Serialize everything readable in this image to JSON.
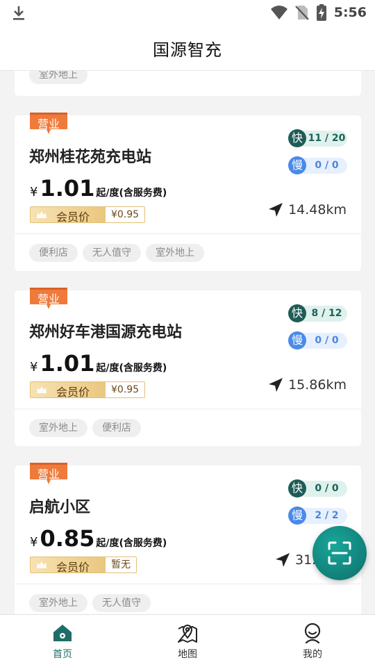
{
  "status_bar": {
    "time": "5:56"
  },
  "header": {
    "title": "国源智充"
  },
  "stub_card": {
    "tags": [
      "室外地上"
    ]
  },
  "stations": [
    {
      "ribbon": "营业",
      "name": "郑州桂花苑充电站",
      "currency": "¥",
      "price": "1.01",
      "unit": "起/度(含服务费)",
      "member_label": "会员价",
      "member_price": "¥0.95",
      "fast_label": "快",
      "fast": "11 / 20",
      "slow_label": "慢",
      "slow": "0 / 0",
      "distance": "14.48km",
      "tags": [
        "便利店",
        "无人值守",
        "室外地上"
      ]
    },
    {
      "ribbon": "营业",
      "name": "郑州好车港国源充电站",
      "currency": "¥",
      "price": "1.01",
      "unit": "起/度(含服务费)",
      "member_label": "会员价",
      "member_price": "¥0.95",
      "fast_label": "快",
      "fast": "8 / 12",
      "slow_label": "慢",
      "slow": "0 / 0",
      "distance": "15.86km",
      "tags": [
        "室外地上",
        "便利店"
      ]
    },
    {
      "ribbon": "营业",
      "name": "启航小区",
      "currency": "¥",
      "price": "0.85",
      "unit": "起/度(含服务费)",
      "member_label": "会员价",
      "member_price": "暂无",
      "fast_label": "快",
      "fast": "0 / 0",
      "slow_label": "慢",
      "slow": "2 / 2",
      "distance": "31.2",
      "tags": [
        "室外地上",
        "无人值守"
      ]
    }
  ],
  "tabbar": {
    "items": [
      {
        "label": "首页",
        "icon": "home-icon",
        "active": true
      },
      {
        "label": "地图",
        "icon": "map-pin-icon",
        "active": false
      },
      {
        "label": "我的",
        "icon": "profile-icon",
        "active": false
      }
    ]
  },
  "colors": {
    "primary": "#1e6e68",
    "ribbon": "#f07a3a",
    "fast": "#1e5d57",
    "slow": "#4a8ae8",
    "gold": "#e3bf74"
  }
}
